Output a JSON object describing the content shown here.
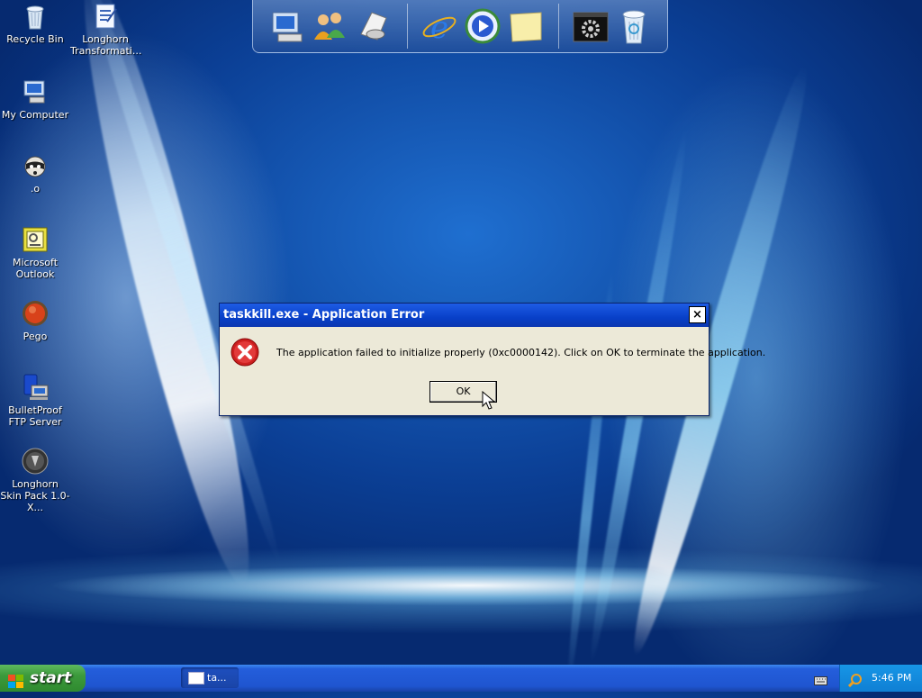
{
  "desktop": {
    "icons": [
      {
        "label": "Recycle Bin",
        "icon": "recycle-bin-icon"
      },
      {
        "label": "Longhorn Transformati...",
        "icon": "transformation-pack-icon"
      },
      {
        "label": "My Computer",
        "icon": "my-computer-icon"
      },
      {
        "label": ".o",
        "icon": "raccoon-icon"
      },
      {
        "label": "Microsoft Outlook",
        "icon": "outlook-icon"
      },
      {
        "label": "Pego",
        "icon": "pego-icon"
      },
      {
        "label": "BulletProof FTP Server",
        "icon": "ftp-server-icon"
      },
      {
        "label": "Longhorn Skin Pack 1.0-X...",
        "icon": "skin-pack-icon"
      }
    ]
  },
  "dock": {
    "items": [
      "my-computer-icon",
      "users-icon",
      "scanner-icon",
      "internet-explorer-icon",
      "media-player-icon",
      "notes-icon",
      "settings-icon",
      "recycle-bin-icon"
    ]
  },
  "dialog": {
    "title": "taskkill.exe - Application Error",
    "close_label": "×",
    "message": "The application failed to initialize properly (0xc0000142). Click on OK to terminate the application.",
    "ok_label": "OK",
    "icon": "error-icon"
  },
  "taskbar": {
    "start_label": "start",
    "task_label": "ta...",
    "clock": "5:46 PM"
  },
  "colors": {
    "titlebar": "#0840c8",
    "dialog_bg": "#ece9d8",
    "start_green": "#3c9a3c",
    "taskbar_blue": "#245edb",
    "error_red": "#cc1f1f"
  }
}
